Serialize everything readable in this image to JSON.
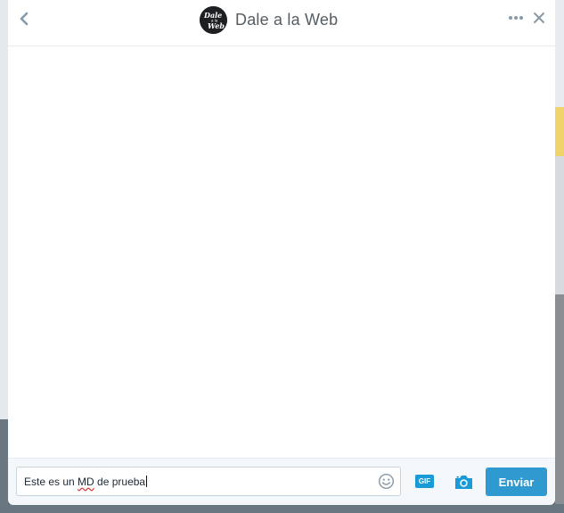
{
  "header": {
    "title": "Dale a la Web",
    "avatar_logo_text": "Dale a la Web"
  },
  "composer": {
    "message_before": "Este es un ",
    "message_misspelled": "MD",
    "message_after": " de prueba",
    "gif_label": "GIF",
    "send_label": "Enviar"
  },
  "icons": {
    "back": "chevron-left-icon",
    "more": "more-dots-icon",
    "close": "close-icon",
    "emoji": "smiley-icon",
    "camera": "camera-icon"
  },
  "colors": {
    "accent": "#2f9ad0",
    "icon_gray": "#8899a6",
    "title": "#555d63"
  }
}
